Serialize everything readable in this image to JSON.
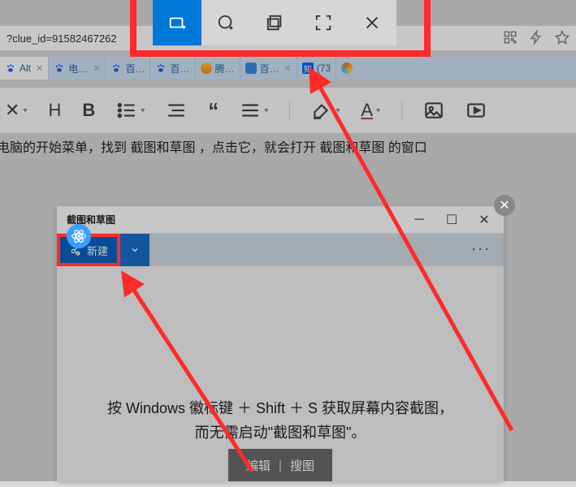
{
  "address_bar": {
    "url_fragment": "?clue_id=91582467262"
  },
  "snip_toolbar": {
    "modes": [
      "rectangular",
      "freeform",
      "window",
      "fullscreen"
    ],
    "close_label": "✕"
  },
  "tabs": [
    {
      "label": "Alt",
      "icon": "baidu",
      "closable": true
    },
    {
      "label": "电…",
      "icon": "baidu",
      "closable": true
    },
    {
      "label": "百…",
      "icon": "baidu",
      "closable": false
    },
    {
      "label": "百…",
      "icon": "baidu",
      "closable": false
    },
    {
      "label": "腾…",
      "icon": "tencent",
      "closable": false
    },
    {
      "label": "百…",
      "icon": "other",
      "closable": true
    },
    {
      "label": "(73",
      "icon": "zhi",
      "closable": false
    }
  ],
  "editor_toolbar": {
    "items": [
      "close",
      "heading",
      "bold",
      "list",
      "indent",
      "quote",
      "align",
      "insert",
      "highlight",
      "fontcolor",
      "image",
      "video"
    ]
  },
  "article": {
    "text": "电脑的开始菜单，找到  截图和草图  ，点击它，就会打开  截图和草图  的窗口"
  },
  "app_window": {
    "title": "截图和草图",
    "new_button": "新建",
    "more": "···",
    "tip_line1": "按 Windows 徽标键 ＋ Shift ＋ S 获取屏幕内容截图，",
    "tip_line2": "而无需启动\"截图和草图\"。",
    "bottom_edit": "编辑",
    "bottom_search": "搜图"
  }
}
